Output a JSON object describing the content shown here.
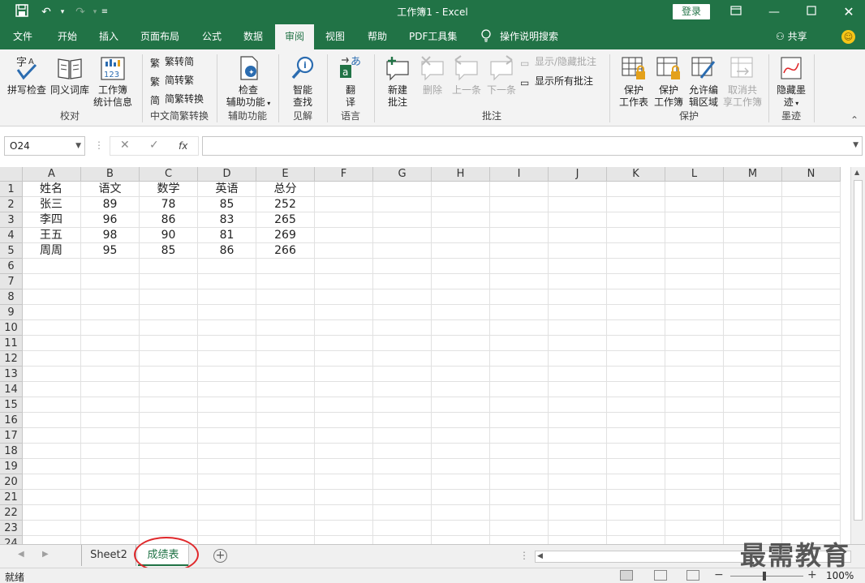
{
  "titlebar": {
    "title": "工作簿1  -  Excel",
    "login": "登录",
    "save_icon": "save-icon",
    "undo_icon": "undo-icon",
    "redo_icon": "redo-icon"
  },
  "tabs": [
    {
      "label": "文件",
      "active": false
    },
    {
      "label": "开始",
      "active": false
    },
    {
      "label": "插入",
      "active": false
    },
    {
      "label": "页面布局",
      "active": false
    },
    {
      "label": "公式",
      "active": false
    },
    {
      "label": "数据",
      "active": false
    },
    {
      "label": "审阅",
      "active": true
    },
    {
      "label": "视图",
      "active": false
    },
    {
      "label": "帮助",
      "active": false
    },
    {
      "label": "PDF工具集",
      "active": false
    },
    {
      "label": "操作说明搜索",
      "active": false
    }
  ],
  "share": "共享",
  "ribbon": {
    "proofing": {
      "label": "校对",
      "spell": "拼写检查",
      "thesaurus": "同义词库",
      "stats_l1": "工作簿",
      "stats_l2": "统计信息"
    },
    "chinese": {
      "label": "中文简繁转换",
      "t2s": "繁转简",
      "s2t": "简转繁",
      "conv": "简繁转换"
    },
    "access": {
      "label": "辅助功能",
      "btn_l1": "检查",
      "btn_l2": "辅助功能"
    },
    "insights": {
      "label": "见解",
      "btn_l1": "智能",
      "btn_l2": "查找"
    },
    "language": {
      "label": "语言",
      "btn_l1": "翻",
      "btn_l2": "译"
    },
    "comments": {
      "label": "批注",
      "new_l1": "新建",
      "new_l2": "批注",
      "delete": "删除",
      "prev": "上一条",
      "next": "下一条",
      "show_hide": "显示/隐藏批注",
      "show_all": "显示所有批注"
    },
    "protect": {
      "label": "保护",
      "sheet_l1": "保护",
      "sheet_l2": "工作表",
      "wb_l1": "保护",
      "wb_l2": "工作簿",
      "range_l1": "允许编",
      "range_l2": "辑区域",
      "unshare_l1": "取消共",
      "unshare_l2": "享工作簿"
    },
    "ink": {
      "label": "墨迹",
      "btn_l1": "隐藏墨",
      "btn_l2": "迹"
    }
  },
  "formula_bar": {
    "name_box": "O24",
    "cancel": "✕",
    "enter": "✓",
    "fx": "fx",
    "value": ""
  },
  "columns": [
    "A",
    "B",
    "C",
    "D",
    "E",
    "F",
    "G",
    "H",
    "I",
    "J",
    "K",
    "L",
    "M",
    "N"
  ],
  "rows": [
    "1",
    "2",
    "3",
    "4",
    "5",
    "6",
    "7",
    "8",
    "9",
    "10",
    "11",
    "12",
    "13",
    "14",
    "15",
    "16",
    "17",
    "18",
    "19",
    "20",
    "21",
    "22",
    "23",
    "24"
  ],
  "cells": [
    [
      "姓名",
      "语文",
      "数学",
      "英语",
      "总分"
    ],
    [
      "张三",
      "89",
      "78",
      "85",
      "252"
    ],
    [
      "李四",
      "96",
      "86",
      "83",
      "265"
    ],
    [
      "王五",
      "98",
      "90",
      "81",
      "269"
    ],
    [
      "周周",
      "95",
      "85",
      "86",
      "266"
    ]
  ],
  "sheets": [
    {
      "label": "Sheet2",
      "active": false
    },
    {
      "label": "成绩表",
      "active": true
    }
  ],
  "status": {
    "ready": "就绪",
    "zoom": "100%",
    "minus": "−",
    "plus": "+"
  },
  "watermark": "最需教育",
  "colors": {
    "brand": "#217346",
    "highlight": "#e0282b"
  }
}
